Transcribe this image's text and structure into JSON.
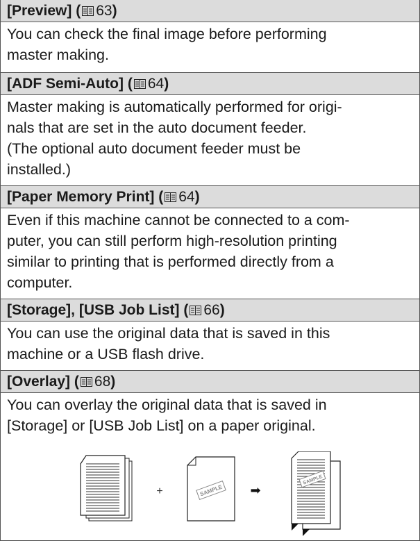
{
  "entries": [
    {
      "title": "[Preview]",
      "page": "63",
      "lines": [
        "You can check the final image before performing",
        "master making."
      ]
    },
    {
      "title": "[ADF Semi-Auto]",
      "page": "64",
      "lines": [
        "Master making is automatically performed for origi-",
        "nals that are set in the auto document feeder.",
        "(The optional auto document feeder must be",
        "installed.)"
      ]
    },
    {
      "title": "[Paper Memory Print]",
      "page": "64",
      "lines": [
        "Even if this machine cannot be connected to a com-",
        "puter, you can still perform high-resolution printing",
        "similar to printing that is performed directly from a",
        "computer."
      ]
    },
    {
      "title": "[Storage], [USB Job List]",
      "page": "66",
      "lines": [
        "You can use the original data that is saved in this",
        "machine or a USB flash drive."
      ]
    },
    {
      "title": "[Overlay]",
      "page": "68",
      "lines": [
        "You can overlay the original data that is saved in",
        "[Storage] or [USB Job List] on a paper original."
      ]
    }
  ],
  "illustration": {
    "plus": "+",
    "arrow": "➡",
    "stamp": "SAMPLE"
  },
  "paren_open": "(",
  "paren_close": ")"
}
